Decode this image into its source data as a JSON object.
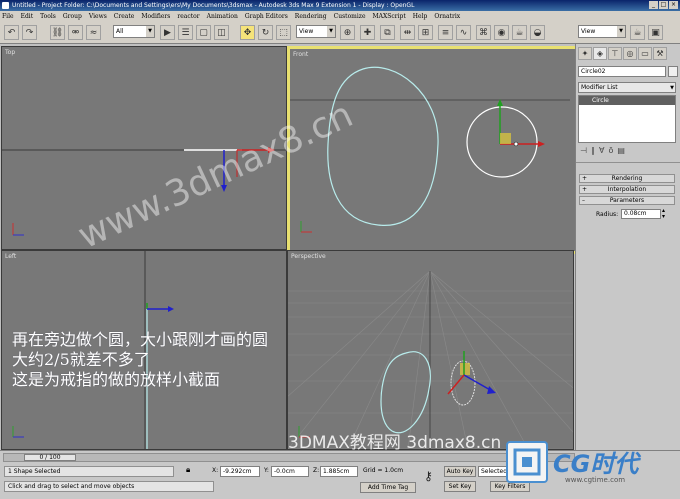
{
  "window": {
    "title": "Untitled    - Project Folder: C:\\Documents and Settings\\ers\\My Documents\\3dsmax    - Autodesk 3ds Max 9 Extension 1         - Display : OpenGL"
  },
  "menu": [
    "File",
    "Edit",
    "Tools",
    "Group",
    "Views",
    "Create",
    "Modifiers",
    "reactor",
    "Animation",
    "Graph Editors",
    "Rendering",
    "Customize",
    "MAXScript",
    "Help",
    "Ornatrix"
  ],
  "toolbar": {
    "selection_filter": "All",
    "ref_coord": "View",
    "named_selection": "View"
  },
  "viewports": {
    "top": "Top",
    "front": "Front",
    "left": "Left",
    "perspective": "Perspective"
  },
  "command_panel": {
    "object_name": "Circle02",
    "modifier_list": "Modifier List",
    "stack_item": "Circle",
    "rollouts": {
      "rendering": "Rendering",
      "interpolation": "Interpolation",
      "parameters": "Parameters"
    },
    "radius_label": "Radius:",
    "radius_value": "0.08cm"
  },
  "caption": {
    "line1": "再在旁边做个圆，大小跟刚才画的圆",
    "line2": "大约2/5就差不多了",
    "line3": "这是为戒指的做的放样小截面"
  },
  "watermarks": {
    "diagonal": "www.3dmax8.cn",
    "bottom": "3DMAX教程网 3dmax8.cn",
    "logo_text": "CG时代",
    "logo_url": "www.cgtime.com"
  },
  "status": {
    "time_slider": "0 / 100",
    "selection": "1 Shape Selected",
    "prompt": "Click and drag to select and move objects",
    "x_label": "X:",
    "x_value": "-9.292cm",
    "y_label": "Y:",
    "y_value": "-0.0cm",
    "z_label": "Z:",
    "z_value": "1.885cm",
    "grid": "Grid = 1.0cm",
    "add_time_tag": "Add Time Tag",
    "auto_key": "Auto Key",
    "set_key": "Set Key",
    "key_mode": "Selected",
    "key_filters": "Key Filters"
  },
  "colors": {
    "viewport_bg": "#787878",
    "active_border": "#e8e070",
    "spline": "#b8ecec",
    "title_bar": "#0a246a"
  },
  "icons": {
    "undo": "undo-icon",
    "redo": "redo-icon",
    "select": "select-icon",
    "move": "move-icon",
    "rotate": "rotate-icon",
    "scale": "scale-icon",
    "render": "render-teapot-icon",
    "lock": "lock-icon",
    "key": "key-icon"
  }
}
